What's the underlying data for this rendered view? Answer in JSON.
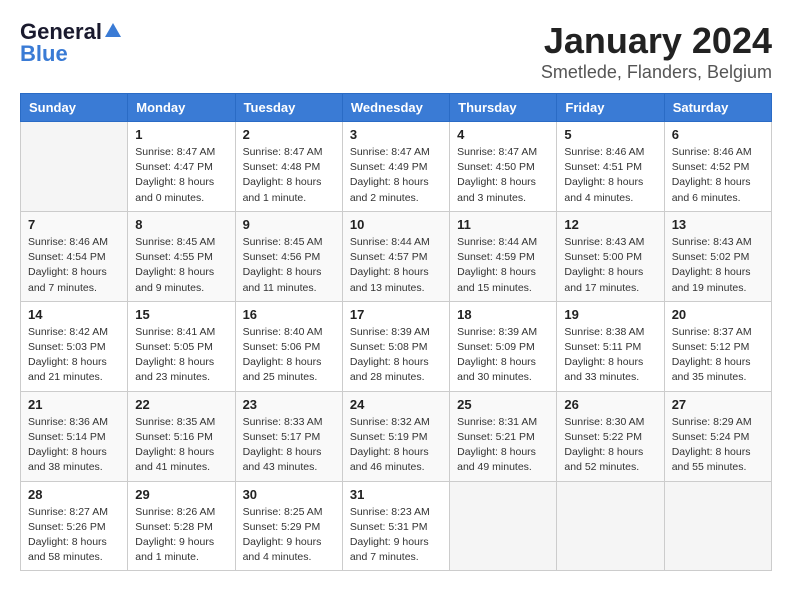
{
  "header": {
    "logo_general": "General",
    "logo_blue": "Blue",
    "title": "January 2024",
    "subtitle": "Smetlede, Flanders, Belgium"
  },
  "calendar": {
    "days_of_week": [
      "Sunday",
      "Monday",
      "Tuesday",
      "Wednesday",
      "Thursday",
      "Friday",
      "Saturday"
    ],
    "weeks": [
      [
        {
          "day": "",
          "info": ""
        },
        {
          "day": "1",
          "info": "Sunrise: 8:47 AM\nSunset: 4:47 PM\nDaylight: 8 hours\nand 0 minutes."
        },
        {
          "day": "2",
          "info": "Sunrise: 8:47 AM\nSunset: 4:48 PM\nDaylight: 8 hours\nand 1 minute."
        },
        {
          "day": "3",
          "info": "Sunrise: 8:47 AM\nSunset: 4:49 PM\nDaylight: 8 hours\nand 2 minutes."
        },
        {
          "day": "4",
          "info": "Sunrise: 8:47 AM\nSunset: 4:50 PM\nDaylight: 8 hours\nand 3 minutes."
        },
        {
          "day": "5",
          "info": "Sunrise: 8:46 AM\nSunset: 4:51 PM\nDaylight: 8 hours\nand 4 minutes."
        },
        {
          "day": "6",
          "info": "Sunrise: 8:46 AM\nSunset: 4:52 PM\nDaylight: 8 hours\nand 6 minutes."
        }
      ],
      [
        {
          "day": "7",
          "info": "Sunrise: 8:46 AM\nSunset: 4:54 PM\nDaylight: 8 hours\nand 7 minutes."
        },
        {
          "day": "8",
          "info": "Sunrise: 8:45 AM\nSunset: 4:55 PM\nDaylight: 8 hours\nand 9 minutes."
        },
        {
          "day": "9",
          "info": "Sunrise: 8:45 AM\nSunset: 4:56 PM\nDaylight: 8 hours\nand 11 minutes."
        },
        {
          "day": "10",
          "info": "Sunrise: 8:44 AM\nSunset: 4:57 PM\nDaylight: 8 hours\nand 13 minutes."
        },
        {
          "day": "11",
          "info": "Sunrise: 8:44 AM\nSunset: 4:59 PM\nDaylight: 8 hours\nand 15 minutes."
        },
        {
          "day": "12",
          "info": "Sunrise: 8:43 AM\nSunset: 5:00 PM\nDaylight: 8 hours\nand 17 minutes."
        },
        {
          "day": "13",
          "info": "Sunrise: 8:43 AM\nSunset: 5:02 PM\nDaylight: 8 hours\nand 19 minutes."
        }
      ],
      [
        {
          "day": "14",
          "info": "Sunrise: 8:42 AM\nSunset: 5:03 PM\nDaylight: 8 hours\nand 21 minutes."
        },
        {
          "day": "15",
          "info": "Sunrise: 8:41 AM\nSunset: 5:05 PM\nDaylight: 8 hours\nand 23 minutes."
        },
        {
          "day": "16",
          "info": "Sunrise: 8:40 AM\nSunset: 5:06 PM\nDaylight: 8 hours\nand 25 minutes."
        },
        {
          "day": "17",
          "info": "Sunrise: 8:39 AM\nSunset: 5:08 PM\nDaylight: 8 hours\nand 28 minutes."
        },
        {
          "day": "18",
          "info": "Sunrise: 8:39 AM\nSunset: 5:09 PM\nDaylight: 8 hours\nand 30 minutes."
        },
        {
          "day": "19",
          "info": "Sunrise: 8:38 AM\nSunset: 5:11 PM\nDaylight: 8 hours\nand 33 minutes."
        },
        {
          "day": "20",
          "info": "Sunrise: 8:37 AM\nSunset: 5:12 PM\nDaylight: 8 hours\nand 35 minutes."
        }
      ],
      [
        {
          "day": "21",
          "info": "Sunrise: 8:36 AM\nSunset: 5:14 PM\nDaylight: 8 hours\nand 38 minutes."
        },
        {
          "day": "22",
          "info": "Sunrise: 8:35 AM\nSunset: 5:16 PM\nDaylight: 8 hours\nand 41 minutes."
        },
        {
          "day": "23",
          "info": "Sunrise: 8:33 AM\nSunset: 5:17 PM\nDaylight: 8 hours\nand 43 minutes."
        },
        {
          "day": "24",
          "info": "Sunrise: 8:32 AM\nSunset: 5:19 PM\nDaylight: 8 hours\nand 46 minutes."
        },
        {
          "day": "25",
          "info": "Sunrise: 8:31 AM\nSunset: 5:21 PM\nDaylight: 8 hours\nand 49 minutes."
        },
        {
          "day": "26",
          "info": "Sunrise: 8:30 AM\nSunset: 5:22 PM\nDaylight: 8 hours\nand 52 minutes."
        },
        {
          "day": "27",
          "info": "Sunrise: 8:29 AM\nSunset: 5:24 PM\nDaylight: 8 hours\nand 55 minutes."
        }
      ],
      [
        {
          "day": "28",
          "info": "Sunrise: 8:27 AM\nSunset: 5:26 PM\nDaylight: 8 hours\nand 58 minutes."
        },
        {
          "day": "29",
          "info": "Sunrise: 8:26 AM\nSunset: 5:28 PM\nDaylight: 9 hours\nand 1 minute."
        },
        {
          "day": "30",
          "info": "Sunrise: 8:25 AM\nSunset: 5:29 PM\nDaylight: 9 hours\nand 4 minutes."
        },
        {
          "day": "31",
          "info": "Sunrise: 8:23 AM\nSunset: 5:31 PM\nDaylight: 9 hours\nand 7 minutes."
        },
        {
          "day": "",
          "info": ""
        },
        {
          "day": "",
          "info": ""
        },
        {
          "day": "",
          "info": ""
        }
      ]
    ]
  }
}
